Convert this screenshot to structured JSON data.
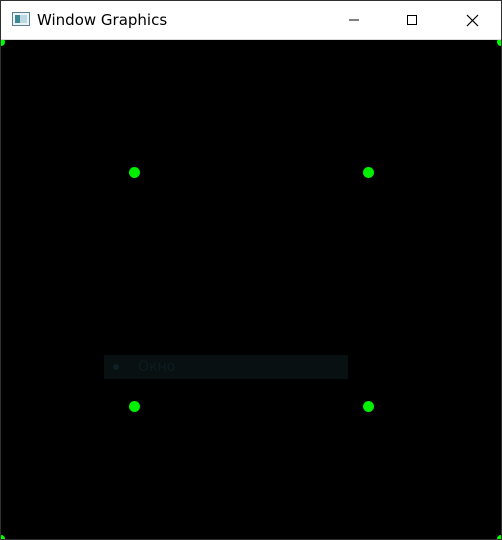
{
  "window": {
    "title": "Window Graphics",
    "app_icon": "app-window-icon",
    "controls": {
      "minimize_icon": "minimize-icon",
      "maximize_icon": "maximize-icon",
      "close_icon": "close-icon"
    }
  },
  "canvas": {
    "background_color": "#000000",
    "point_color": "#00ff00",
    "label": {
      "text": "Окно",
      "background_color": "#081012",
      "text_color": "#0b1c20"
    }
  }
}
